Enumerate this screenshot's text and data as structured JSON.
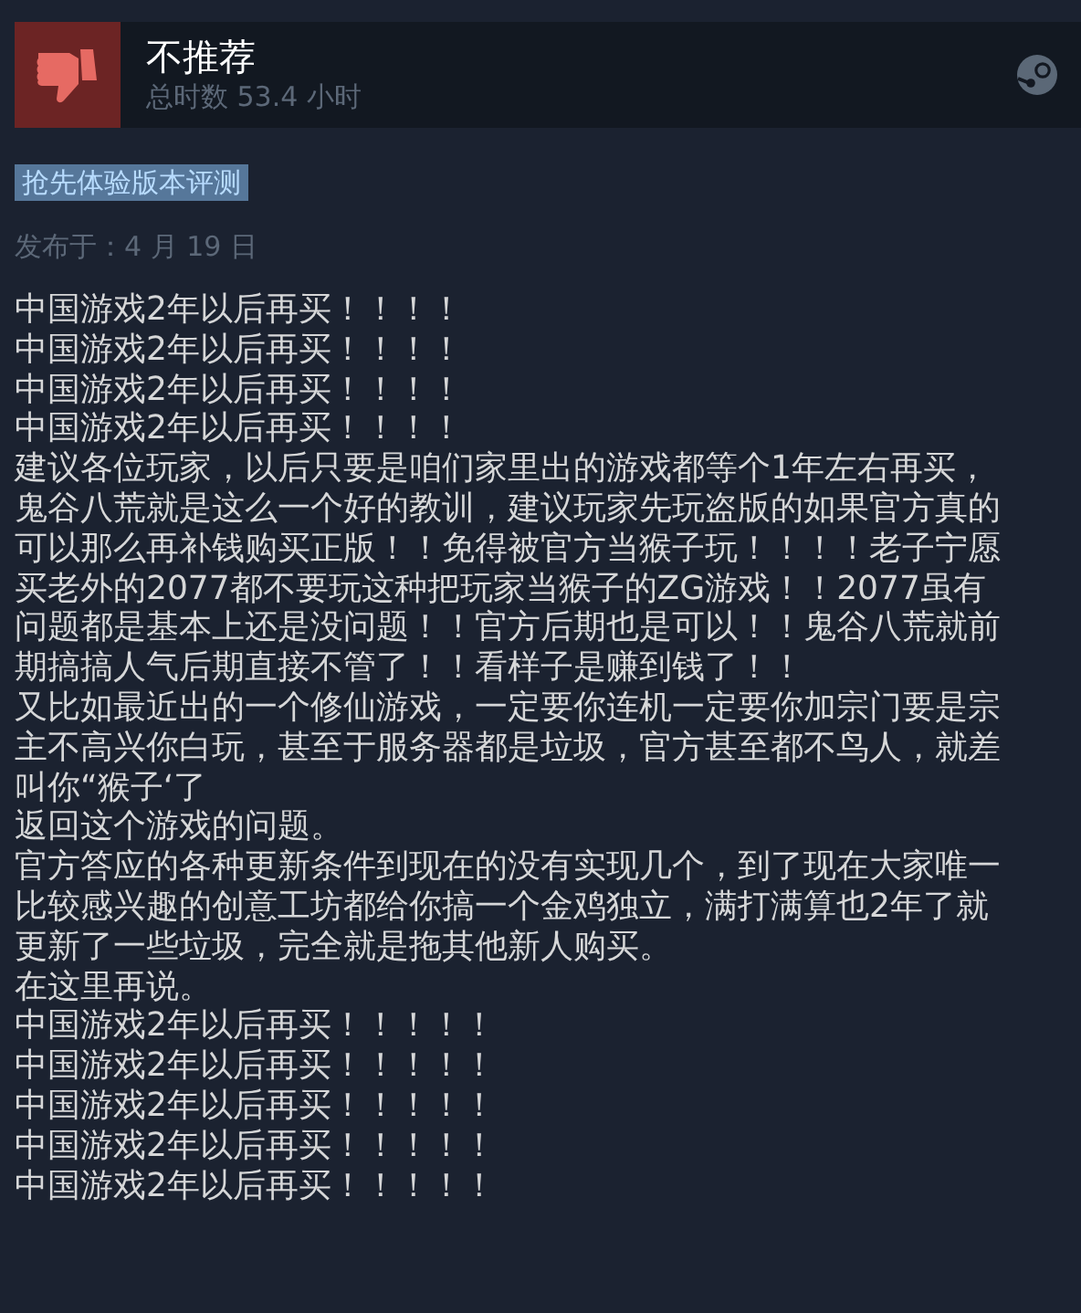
{
  "review": {
    "verdict": "不推荐",
    "recommended": false,
    "hours": "总时数 53.4 小时",
    "badge": "抢先体验版本评测",
    "posted": "发布于：4 月 19 日"
  },
  "paragraphs": [
    {
      "lines": [
        "中国游戏2年以后再买！！！！"
      ]
    },
    {
      "lines": [
        "中国游戏2年以后再买！！！！"
      ]
    },
    {
      "lines": [
        "中国游戏2年以后再买！！！！"
      ]
    },
    {
      "lines": [
        "中国游戏2年以后再买！！！！"
      ]
    },
    {
      "lines": [
        "建议各位玩家，以后只要是咱们家里出的游戏都等个1年左右再买，",
        "鬼谷八荒就是这么一个好的教训，建议玩家先玩盗版的如果官方真的",
        "可以那么再补钱购买正版！！免得被官方当猴子玩！！！！老子宁愿",
        "买老外的2077都不要玩这种把玩家当猴子的ZG游戏！！2077虽有",
        "问题都是基本上还是没问题！！官方后期也是可以！！鬼谷八荒就前",
        "期搞搞人气后期直接不管了！！看样子是赚到钱了！！"
      ]
    },
    {
      "lines": [
        "又比如最近出的一个修仙游戏，一定要你连机一定要你加宗门要是宗",
        "主不高兴你白玩，甚至于服务器都是垃圾，官方甚至都不鸟人，就差",
        "叫你“猴子‘了"
      ]
    },
    {
      "lines": [
        "返回这个游戏的问题。"
      ]
    },
    {
      "lines": [
        "官方答应的各种更新条件到现在的没有实现几个，到了现在大家唯一",
        "比较感兴趣的创意工坊都给你搞一个金鸡独立，满打满算也2年了就",
        "更新了一些垃圾，完全就是拖其他新人购买。"
      ]
    },
    {
      "lines": [
        "在这里再说。"
      ]
    },
    {
      "lines": [
        "中国游戏2年以后再买！！！！！"
      ]
    },
    {
      "lines": [
        "中国游戏2年以后再买！！！！！"
      ]
    },
    {
      "lines": [
        "中国游戏2年以后再买！！！！！"
      ]
    },
    {
      "lines": [
        "中国游戏2年以后再买！！！！！"
      ]
    },
    {
      "lines": [
        "中国游戏2年以后再买！！！！！"
      ]
    }
  ]
}
